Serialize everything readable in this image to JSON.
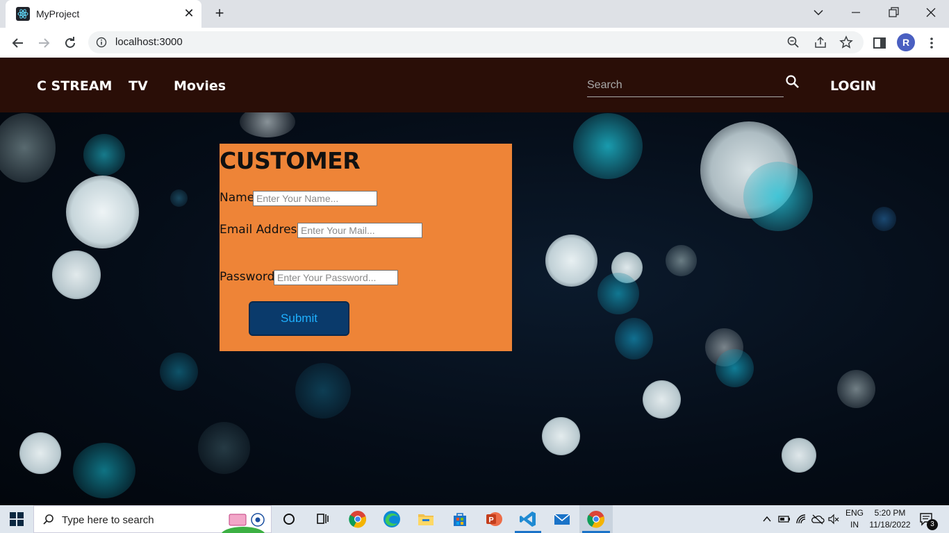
{
  "browser": {
    "tab_title": "MyProject",
    "url": "localhost:3000",
    "profile_initial": "R"
  },
  "navbar": {
    "brand": "C STREAM",
    "links": [
      "TV",
      "Movies"
    ],
    "search_placeholder": "Search",
    "login": "LOGIN"
  },
  "form": {
    "title": "CUSTOMER",
    "name_label": "Name:",
    "name_placeholder": "Enter Your Name...",
    "email_label": "Email Address:",
    "email_placeholder": "Enter Your Mail...",
    "password_label": "Password:",
    "password_placeholder": "Enter Your Password...",
    "submit_label": "Submit"
  },
  "taskbar": {
    "search_placeholder": "Type here to search",
    "lang_top": "ENG",
    "lang_bottom": "IN",
    "time": "5:20 PM",
    "date": "11/18/2022",
    "notifications": "3"
  },
  "colors": {
    "navbar": "#2a0e07",
    "card": "#ee8437",
    "submit_bg": "#0a3a6b",
    "submit_text": "#1fb0ff"
  }
}
